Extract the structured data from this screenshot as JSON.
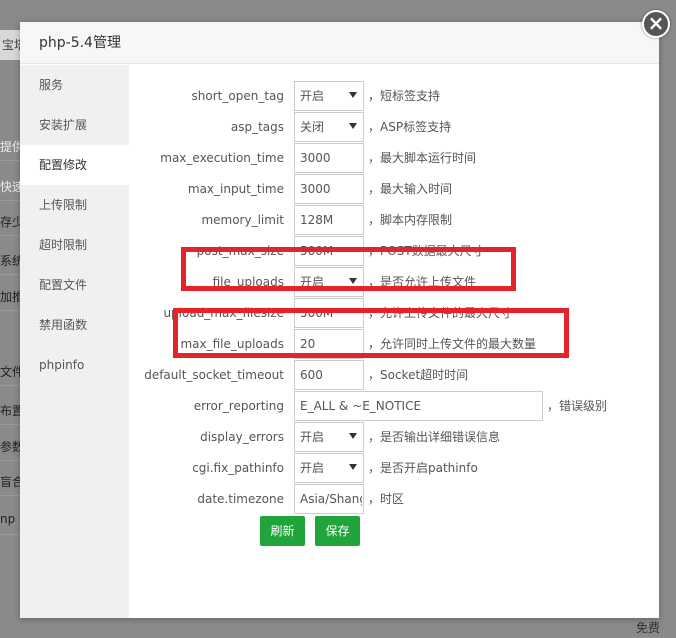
{
  "background": {
    "tab_label": "宝塔",
    "rows": [
      "提供",
      "快速",
      "存少",
      "系统",
      "加推",
      "文件",
      "布置",
      "参数",
      "盲合",
      "np"
    ],
    "footer": "免费"
  },
  "modal": {
    "title": "php-5.4管理",
    "close_symbol": "×"
  },
  "sidebar": {
    "items": [
      {
        "label": "服务"
      },
      {
        "label": "安装扩展"
      },
      {
        "label": "配置修改"
      },
      {
        "label": "上传限制"
      },
      {
        "label": "超时限制"
      },
      {
        "label": "配置文件"
      },
      {
        "label": "禁用函数"
      },
      {
        "label": "phpinfo"
      }
    ],
    "active_index": 2
  },
  "config": {
    "rows": [
      {
        "label": "short_open_tag",
        "value": "开启",
        "type": "select",
        "desc": "，短标签支持"
      },
      {
        "label": "asp_tags",
        "value": "关闭",
        "type": "select",
        "desc": "，ASP标签支持"
      },
      {
        "label": "max_execution_time",
        "value": "3000",
        "type": "input",
        "desc": "，最大脚本运行时间"
      },
      {
        "label": "max_input_time",
        "value": "3000",
        "type": "input",
        "desc": "，最大输入时间"
      },
      {
        "label": "memory_limit",
        "value": "128M",
        "type": "input",
        "desc": "，脚本内存限制"
      },
      {
        "label": "post_max_size",
        "value": "500M",
        "type": "input",
        "desc": "，POST数据最大尺寸"
      },
      {
        "label": "file_uploads",
        "value": "开启",
        "type": "select",
        "desc": "，是否允许上传文件"
      },
      {
        "label": "upload_max_filesize",
        "value": "500M",
        "type": "input",
        "desc": "，允许上传文件的最大尺寸"
      },
      {
        "label": "max_file_uploads",
        "value": "20",
        "type": "input",
        "desc": "，允许同时上传文件的最大数量"
      },
      {
        "label": "default_socket_timeout",
        "value": "600",
        "type": "input",
        "desc": "，Socket超时时间"
      },
      {
        "label": "error_reporting",
        "value": "E_ALL & ~E_NOTICE",
        "type": "wide",
        "desc": "，错误级别"
      },
      {
        "label": "display_errors",
        "value": "开启",
        "type": "select",
        "desc": "，是否输出详细错误信息"
      },
      {
        "label": "cgi.fix_pathinfo",
        "value": "开启",
        "type": "select",
        "desc": "，是否开启pathinfo"
      },
      {
        "label": "date.timezone",
        "value": "Asia/Shanghai",
        "type": "input",
        "desc": "，时区"
      }
    ],
    "refresh_label": "刷新",
    "save_label": "保存"
  },
  "colors": {
    "accent": "#20a53a",
    "highlight": "#e5232a"
  }
}
